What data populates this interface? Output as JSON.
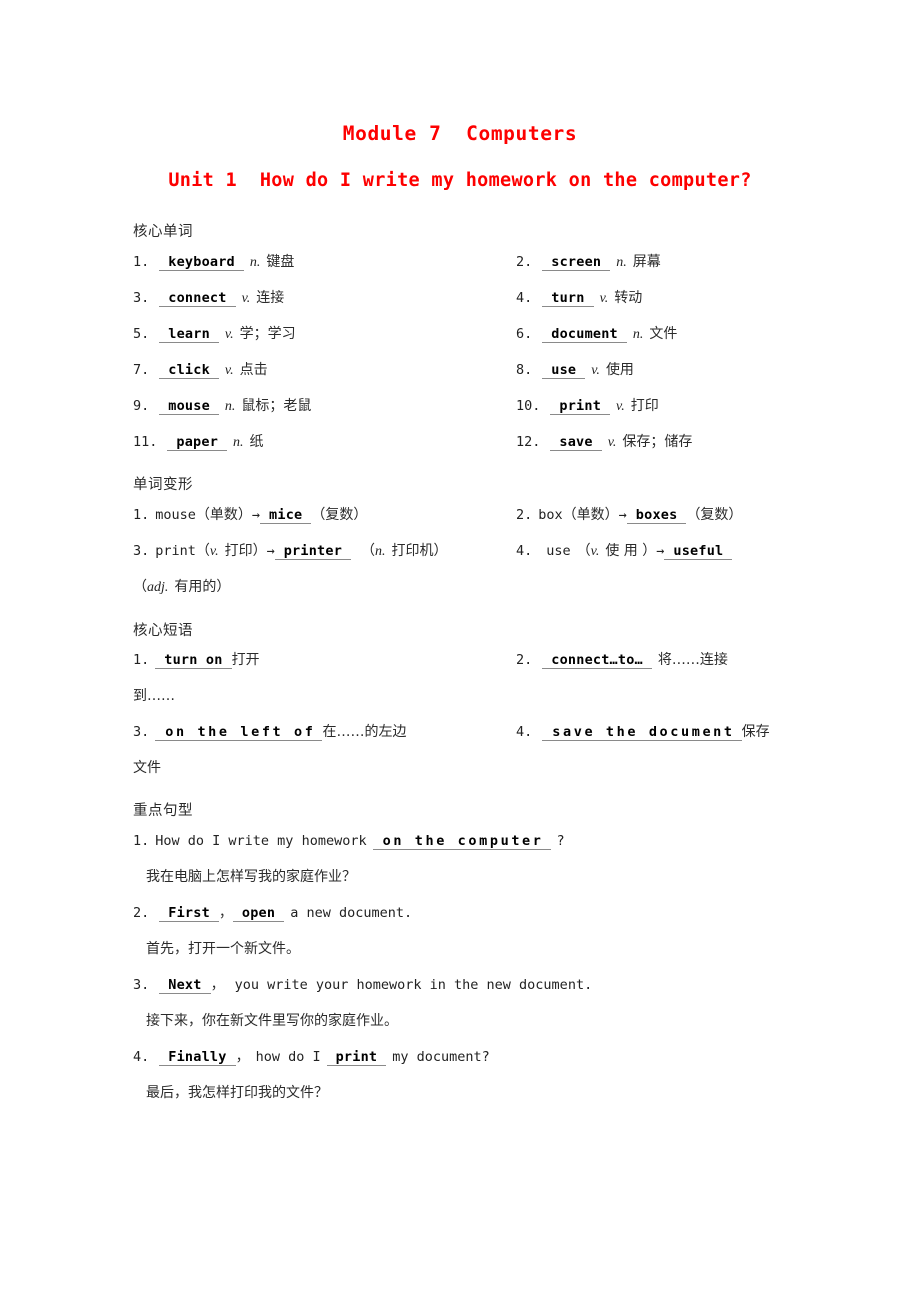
{
  "headings": {
    "module": "Module 7  Computers",
    "unit": "Unit 1  How do I write my homework on the computer?"
  },
  "sections": {
    "core_words": "核心单词",
    "word_forms": "单词变形",
    "core_phrases": "核心短语",
    "key_sentences": "重点句型"
  },
  "core_words": [
    {
      "no": "1.",
      "answer": "keyboard",
      "pos": "n.",
      "meaning": "键盘"
    },
    {
      "no": "2.",
      "answer": "screen",
      "pos": "n.",
      "meaning": "屏幕"
    },
    {
      "no": "3.",
      "answer": "connect",
      "pos": "v.",
      "meaning": "连接"
    },
    {
      "no": "4.",
      "answer": "turn",
      "pos": "v.",
      "meaning": "转动"
    },
    {
      "no": "5.",
      "answer": "learn",
      "pos": "v.",
      "meaning": "学；学习"
    },
    {
      "no": "6.",
      "answer": "document",
      "pos": "n.",
      "meaning": "文件"
    },
    {
      "no": "7.",
      "answer": "click",
      "pos": "v.",
      "meaning": "点击"
    },
    {
      "no": "8.",
      "answer": "use",
      "pos": "v.",
      "meaning": "使用"
    },
    {
      "no": "9.",
      "answer": "mouse",
      "pos": "n.",
      "meaning": "鼠标；老鼠"
    },
    {
      "no": "10.",
      "answer": "print",
      "pos": "v.",
      "meaning": "打印"
    },
    {
      "no": "11.",
      "answer": "paper",
      "pos": "n.",
      "meaning": "纸"
    },
    {
      "no": "12.",
      "answer": "save",
      "pos": "v.",
      "meaning": "保存；储存"
    }
  ],
  "word_forms": [
    {
      "no": "1.",
      "base": "mouse",
      "base_note": "（单数）",
      "arrow": "→",
      "answer": "mice",
      "result_note": "（复数）"
    },
    {
      "no": "2.",
      "base": "box",
      "base_note": "（单数）",
      "arrow": "→",
      "answer": "boxes",
      "result_note": "（复数）"
    },
    {
      "no": "3.",
      "base": "print",
      "base_note_open": "（",
      "base_pos": "v.",
      "base_note_cn": "打印）",
      "arrow": "→",
      "answer": "printer",
      "result_open": "（",
      "result_pos": "n.",
      "result_cn": "打印机）"
    },
    {
      "no": "4.",
      "base": "use",
      "base_note_open": "（",
      "base_pos": "v.",
      "base_note_cn": "使 用 ）",
      "arrow": "→",
      "answer": "useful",
      "result_wrap_open": "（",
      "result_wrap_pos": "adj.",
      "result_wrap_cn": "有用的）"
    }
  ],
  "core_phrases": [
    {
      "no": "1.",
      "answer": "turn  on",
      "meaning": "打开"
    },
    {
      "no": "2.",
      "answer": "connect…to…",
      "meaning": "将……连接",
      "wrap": "到……"
    },
    {
      "no": "3.",
      "answer": "on  the  left  of",
      "meaning": "在……的左边"
    },
    {
      "no": "4.",
      "answer": "save  the  document",
      "meaning": "保存",
      "wrap": "文件"
    }
  ],
  "key_sentences": [
    {
      "no": "1.",
      "before": "How do I write my homework",
      "answer": "on  the  computer",
      "after": "?",
      "translation": "我在电脑上怎样写我的家庭作业？"
    },
    {
      "no": "2.",
      "answer1": "First",
      "mid": "，",
      "answer2": "open",
      "after": "a new document.",
      "translation": "首先，打开一个新文件。"
    },
    {
      "no": "3.",
      "answer1": "Next",
      "mid": "，",
      "after": "you write your homework in the new document.",
      "translation": "接下来，你在新文件里写你的家庭作业。"
    },
    {
      "no": "4.",
      "answer1": "Finally",
      "mid": "，",
      "before2": "how do I",
      "answer2": "print",
      "after": "my document?",
      "translation": "最后，我怎样打印我的文件？"
    }
  ],
  "colors": {
    "heading_red": "#fd0000",
    "body_text": "#222222",
    "rule": "#8a8a8a"
  }
}
